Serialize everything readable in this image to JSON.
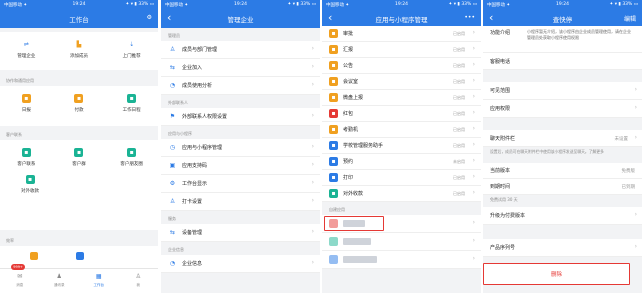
{
  "colors": {
    "brand": "#2c7be5",
    "danger": "#e53935"
  },
  "workbench": {
    "status": {
      "left": "中国移动 ✦",
      "time": "19:24",
      "right": "✦ ▾ ▮ 33% ▭"
    },
    "title": "工作台",
    "admin_items": [
      {
        "label": "管理企业",
        "icon": "admin-icon",
        "color": "#2c7be5"
      },
      {
        "label": "添加成员",
        "icon": "add-member-icon",
        "color": "#f0a020"
      },
      {
        "label": "上门推荐",
        "icon": "recommend-icon",
        "color": "#2c7be5"
      }
    ],
    "sec1_title": "协作和通用应用",
    "apps1": [
      {
        "label": "日报",
        "color": "#f0a020"
      },
      {
        "label": "付款",
        "color": "#f0a020"
      },
      {
        "label": "工作日程",
        "color": "#1ab394"
      }
    ],
    "sec2_title": "客户联系",
    "apps2": [
      {
        "label": "客户联系",
        "color": "#1ab394"
      },
      {
        "label": "客户群",
        "color": "#1ab394"
      },
      {
        "label": "客户朋友圈",
        "color": "#1ab394"
      },
      {
        "label": "对外收款",
        "color": "#1ab394"
      }
    ],
    "sec3_title": "效率",
    "tabs": [
      {
        "label": "消息",
        "badge": "999+"
      },
      {
        "label": "通讯录"
      },
      {
        "label": "工作台"
      },
      {
        "label": "我"
      }
    ]
  },
  "manage": {
    "status": {
      "left": "中国移动 ✦",
      "time": "19:24",
      "right": "✦ ▾ ▮ 33% ▭"
    },
    "title": "管理企业",
    "group1": "管理员",
    "rows1": [
      "成员与部门管理",
      "企业加入",
      "成员使用分析"
    ],
    "group2": "外部联系人",
    "rows2": [
      "外部联系人权限设置"
    ],
    "group3": "应用与小程序",
    "rows3": [
      "应用与小程序管理",
      "应用支持码",
      "工作台显示",
      "打卡设置"
    ],
    "group4": "服务",
    "rows4": [
      "设备管理"
    ],
    "group5": "企业信息",
    "rows5": [
      "企业信息"
    ]
  },
  "apps": {
    "status": {
      "left": "中国移动 ✦",
      "time": "19:24",
      "right": "✦ ▾ ▮ 33% ▭"
    },
    "title": "应用与小程序管理",
    "more": "•••",
    "rows": [
      {
        "label": "审批",
        "status": "已启用",
        "color": "#f0a020"
      },
      {
        "label": "汇报",
        "status": "已启用",
        "color": "#f0a020"
      },
      {
        "label": "公告",
        "status": "已启用",
        "color": "#f0a020"
      },
      {
        "label": "会议室",
        "status": "已启用",
        "color": "#f0a020"
      },
      {
        "label": "微盘上报",
        "status": "已启用",
        "color": "#f0a020"
      },
      {
        "label": "红包",
        "status": "已启用",
        "color": "#e53935"
      },
      {
        "label": "考勤机",
        "status": "已启用",
        "color": "#f0a020"
      },
      {
        "label": "学校管理服务助手",
        "status": "已启用",
        "color": "#2c7be5"
      },
      {
        "label": "预约",
        "status": "未启用",
        "color": "#2c7be5"
      },
      {
        "label": "打印",
        "status": "已启用",
        "color": "#2c7be5"
      },
      {
        "label": "对外收款",
        "status": "已启用",
        "color": "#1ab394"
      }
    ],
    "group_custom": "自建应用",
    "more_custom_rows": 3
  },
  "detail": {
    "status": {
      "left": "中国移动 ✦",
      "time": "19:24",
      "right": "✦ ▾ ▮ 33% ▭"
    },
    "title": "查快停",
    "edit": "编辑",
    "intro_key": "功能介绍",
    "intro_val": "小程序暂无介绍，该小程序由企业成员管理使用，请在企业管理员处获取小程序使用权限",
    "owner_key": "客服电话",
    "scope_key": "可见范围",
    "perm_key": "应用权限",
    "home_key": "聊天附件栏",
    "home_val": "未设置",
    "home_note": "设置后，成员可在聊天附件栏中使用该小程序发送至聊天。了解更多",
    "ver_key": "当前版本",
    "ver_val": "免费版",
    "expire_key": "到期时间",
    "expire_val": "已到期",
    "group_note": "免费试用 30 天",
    "upgrade_key": "升级为付费版本",
    "serial_key": "产品序列号",
    "delete_label": "删除"
  }
}
